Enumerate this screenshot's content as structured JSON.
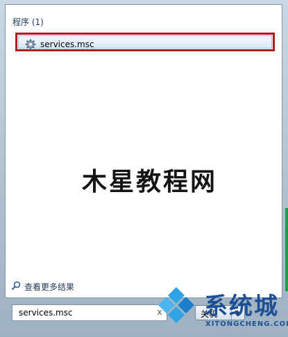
{
  "results": {
    "section_title": "程序 (1)",
    "items": [
      {
        "label": "services.msc",
        "icon": "gear-icon"
      }
    ]
  },
  "watermark": "木星教程网",
  "footer": {
    "see_more": "查看更多结果",
    "search_value": "services.msc",
    "clear_glyph": "x",
    "shutdown_label": "关机",
    "shutdown_arrow": "▶"
  },
  "logo": {
    "text": "系统城",
    "sub": "XITONGCHENG.COM"
  },
  "colors": {
    "highlight_border": "#b21a1a",
    "logo_blue": "#1d4f96",
    "logo_accent": "#2fa3e6"
  }
}
